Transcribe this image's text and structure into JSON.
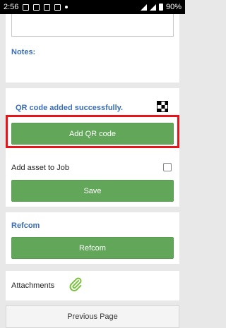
{
  "statusbar": {
    "time": "2:56",
    "battery": "90%"
  },
  "notes": {
    "label": "Notes:"
  },
  "qr": {
    "message": "QR code added successfully.",
    "add_button": "Add QR code"
  },
  "asset": {
    "label": "Add asset to Job",
    "checked": false,
    "save_button": "Save"
  },
  "refcom": {
    "title": "Refcom",
    "button": "Refcom"
  },
  "attachments": {
    "label": "Attachments"
  },
  "navigation": {
    "previous_page": "Previous Page"
  },
  "colors": {
    "accent_green": "#62a65a",
    "heading_blue": "#3a6db5",
    "highlight_red": "#e8141a"
  }
}
